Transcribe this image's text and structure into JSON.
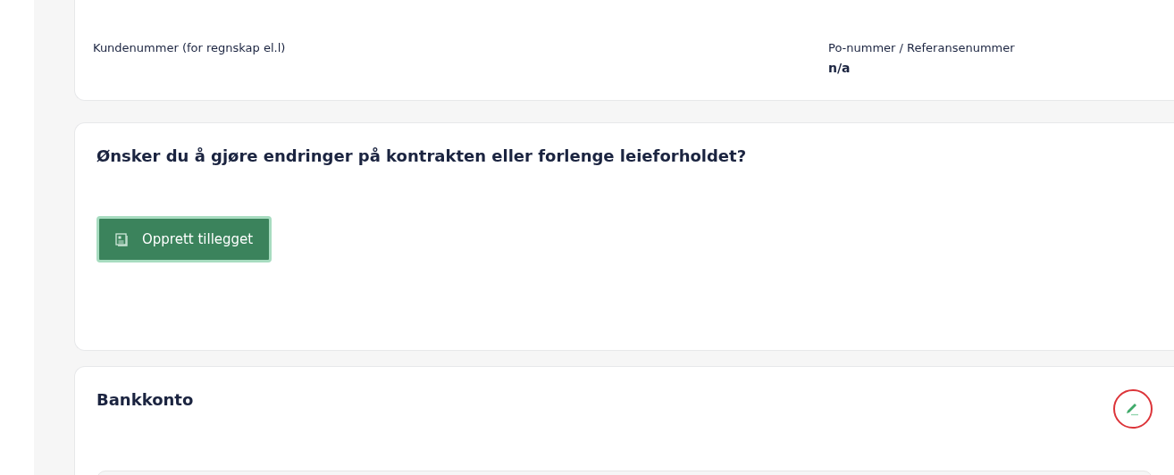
{
  "customer_card": {
    "fields": [
      {
        "label": "Kundenummer (for regnskap el.l)"
      },
      {
        "label": "Po-nummer / Referansenummer",
        "value": "n/a"
      }
    ]
  },
  "amendment_card": {
    "heading": "Ønsker du å gjøre endringer på kontrakten eller forlenge leieforholdet?",
    "button": "Opprett tillegget"
  },
  "bank_card": {
    "heading": "Bankkonto",
    "edit_focused": true
  }
}
